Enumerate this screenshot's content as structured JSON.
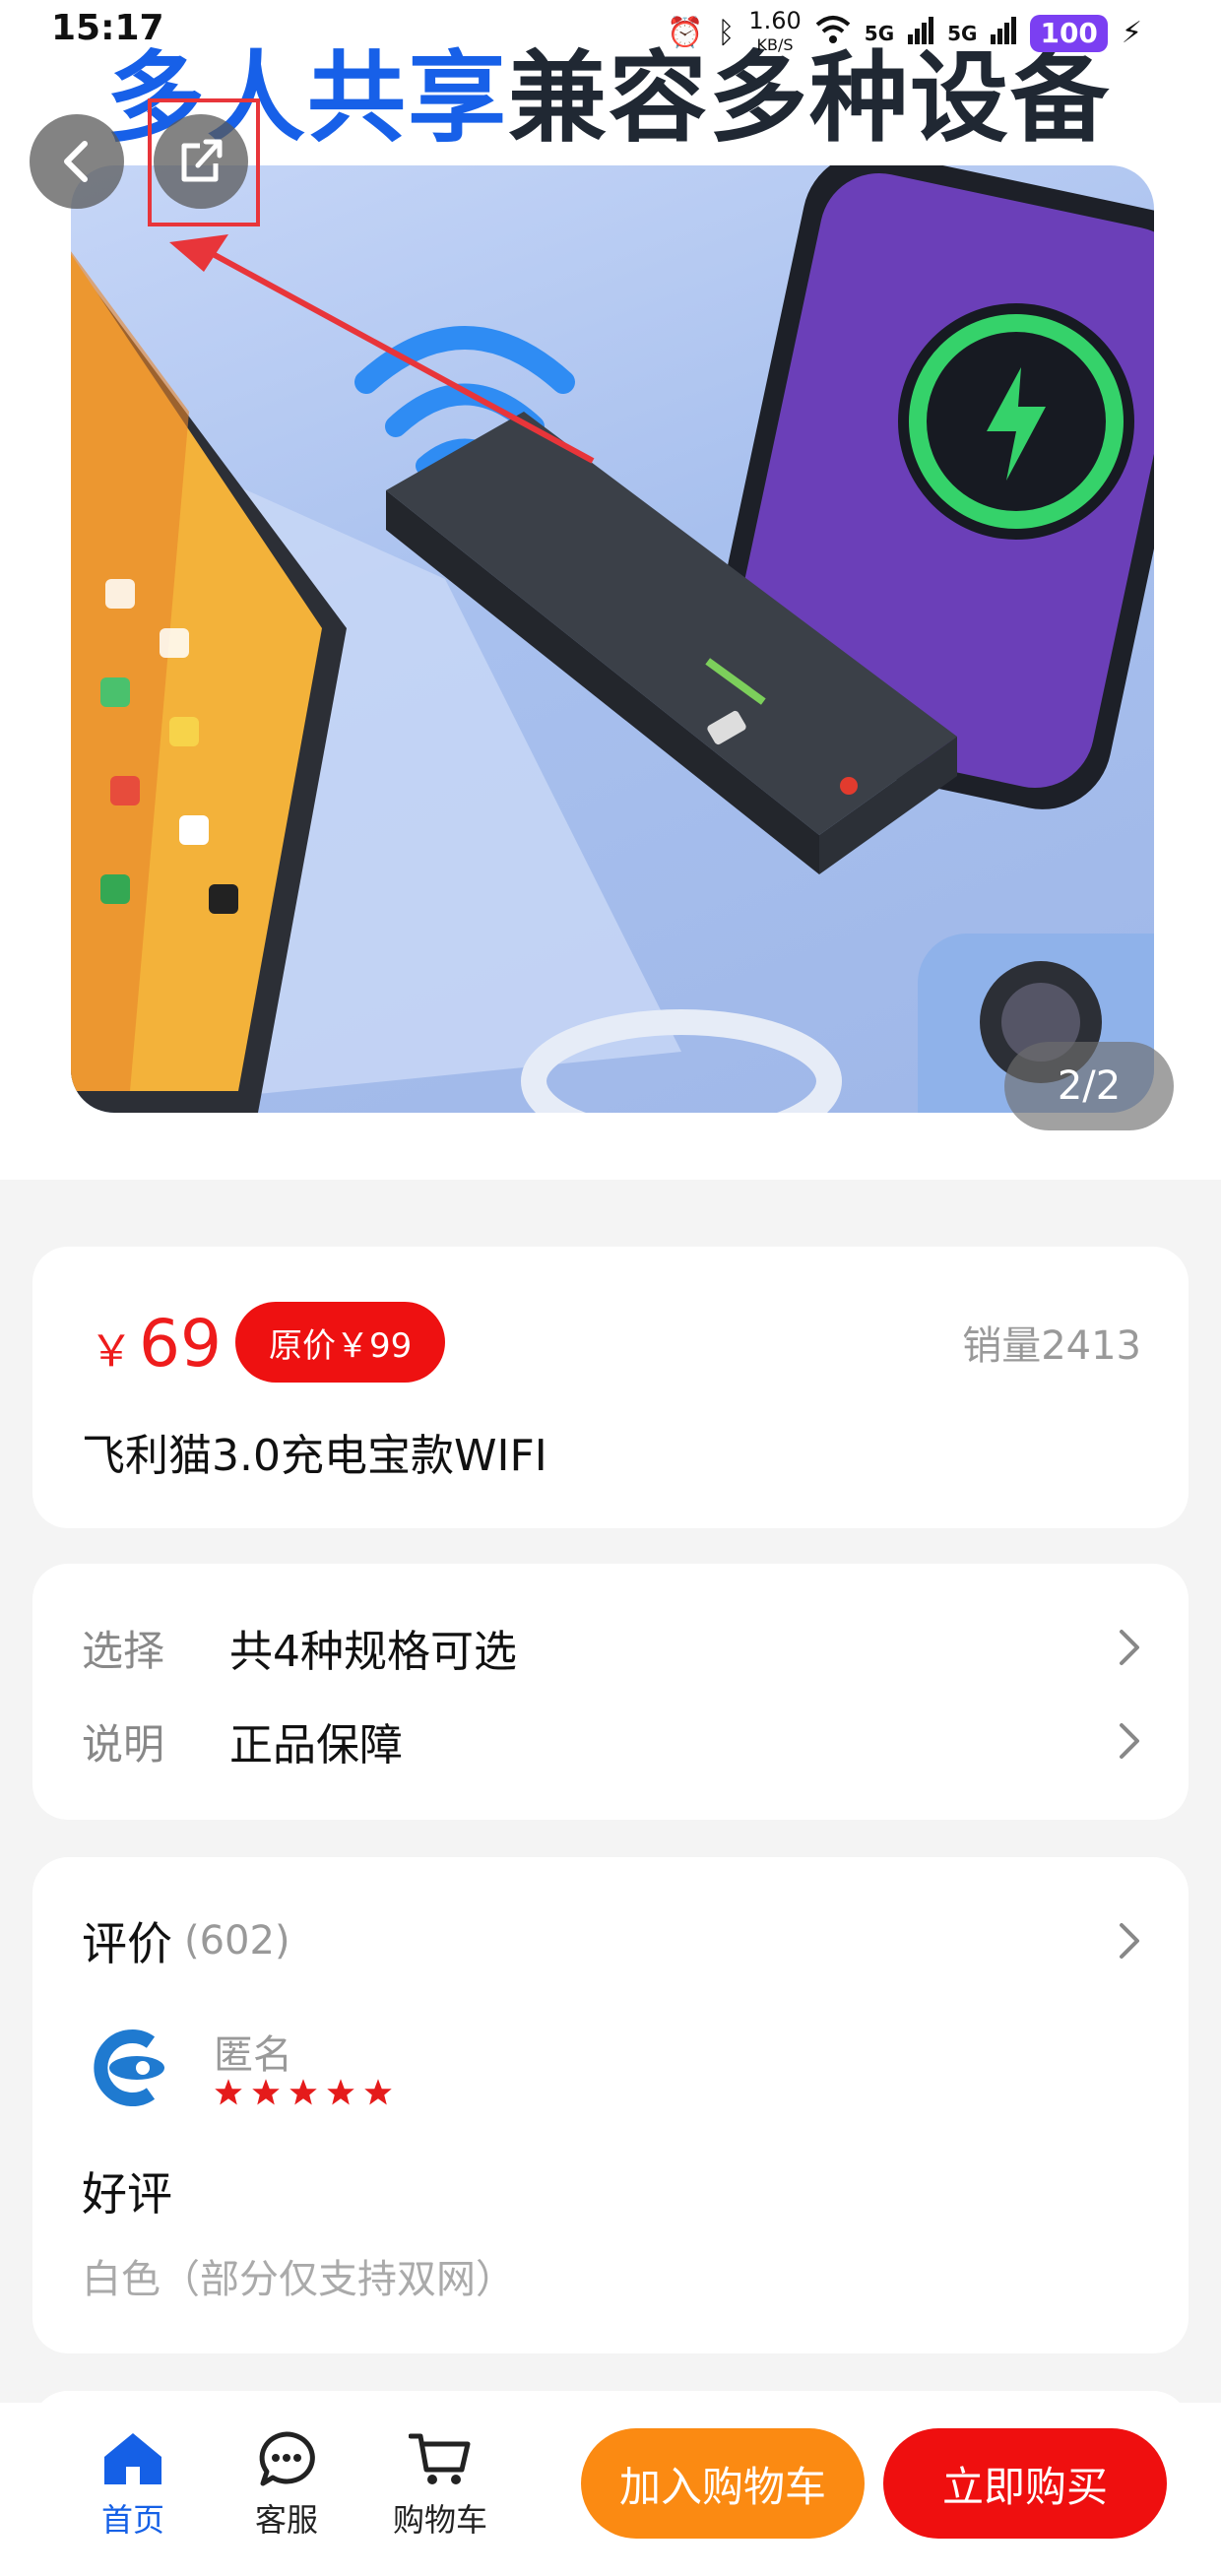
{
  "status_bar": {
    "time": "15:17",
    "speed": "1.60",
    "speed_unit": "KB/S",
    "network_1": "5G",
    "network_2": "5G",
    "battery": "100"
  },
  "hero": {
    "headline_blue": "多人共享",
    "headline_dark": "兼容多种设备",
    "pager": "2/2"
  },
  "product": {
    "currency": "￥",
    "price": "69",
    "original_price": "原价￥99",
    "sales": "销量2413",
    "title": "飞利猫3.0充电宝款WIFI"
  },
  "specs": [
    {
      "label": "选择",
      "value": "共4种规格可选"
    },
    {
      "label": "说明",
      "value": "正品保障"
    }
  ],
  "reviews": {
    "title": "评价",
    "count": "(602)",
    "reviewer": "匿名",
    "rating": 5,
    "text": "好评",
    "variant": "白色（部分仅支持双网）"
  },
  "bottom_nav": {
    "home": "首页",
    "service": "客服",
    "cart": "购物车",
    "add_to_cart": "加入购物车",
    "buy_now": "立即购买"
  },
  "colors": {
    "accent_red": "#ee1c1c",
    "cart_orange": "#fb8a12",
    "home_blue": "#1560e6"
  }
}
